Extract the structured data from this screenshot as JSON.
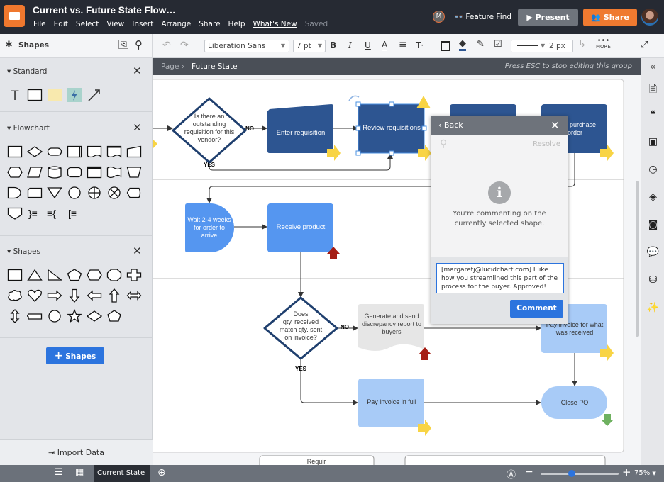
{
  "app": {
    "title": "Current vs. Future State Flow…",
    "menu": [
      "File",
      "Edit",
      "Select",
      "View",
      "Insert",
      "Arrange",
      "Share",
      "Help",
      "What's New"
    ],
    "saved": "Saved",
    "collab_initial": "M",
    "feature_find": "Feature Find",
    "present": "Present",
    "share": "Share"
  },
  "toolbar": {
    "font": "Liberation Sans",
    "font_size": "7 pt",
    "line_width": "2 px",
    "more": "MORE",
    "fill_color": "#2d5591"
  },
  "sidebar": {
    "title": "Shapes",
    "sections": [
      {
        "name": "Standard",
        "shapes": [
          "text",
          "rect",
          "note",
          "action",
          "arrow"
        ]
      },
      {
        "name": "Flowchart",
        "shapes": [
          "rect",
          "diamond",
          "terminator",
          "process2",
          "document",
          "doc2",
          "manual-input",
          "hexagon",
          "parallelogram",
          "cylinder",
          "direct-data",
          "internal",
          "tape",
          "trapezoid",
          "delay",
          "card",
          "triangle-down",
          "circle",
          "or",
          "sum",
          "display",
          "offpage",
          "brace-r",
          "brace-l",
          "bracket"
        ]
      },
      {
        "name": "Shapes",
        "shapes": [
          "rect",
          "triangle",
          "right-triangle",
          "pentagon",
          "hexagon",
          "octagon",
          "cross",
          "cloud",
          "heart",
          "arrow-right",
          "arrow-down",
          "arrow-left",
          "arrow-up",
          "arrow-lr",
          "arrow-ud",
          "callout",
          "circle",
          "star",
          "diamond",
          "polygon"
        ]
      }
    ],
    "add_shapes": "Shapes",
    "import_data": "Import Data"
  },
  "breadcrumb": {
    "root": "Page",
    "current": "Future State",
    "hint": "Press ESC to stop editing this group"
  },
  "diagram": {
    "colors": {
      "dark": "#2d5591",
      "mid": "#5596f0",
      "light": "#a8cbf7",
      "gray": "#e6e6e6",
      "yellow": "#f8d444",
      "red": "#a51d14",
      "green": "#6fb160"
    },
    "decision1": [
      "Is there an",
      "outstanding",
      "requisition for this",
      "vendor?"
    ],
    "enter_requisition": "Enter requisition",
    "review_requisitions": "Review requisitions",
    "purchase_order_fragment": [
      "t purchase",
      "order"
    ],
    "wait": [
      "Wait 2-4 weeks",
      "for order to",
      "arrive"
    ],
    "receive_product": "Receive product",
    "decision2": [
      "Does",
      "qty. received",
      "match qty. sent",
      "on invoice?"
    ],
    "discrepancy": [
      "Generate and send",
      "discrepancy report to",
      "buyers"
    ],
    "pay_received": [
      "Pay invoice for what",
      "was received"
    ],
    "pay_full": "Pay invoice in full",
    "close_po": "Close PO",
    "no": "NO",
    "yes": "YES",
    "bottom_fragment": "Requir"
  },
  "comment_panel": {
    "back": "Back",
    "resolve": "Resolve",
    "message": [
      "You're commenting on the",
      "currently selected shape."
    ],
    "input_value": "[margaretj@lucidchart.com] I like how you streamlined this part of the process for the buyer. Approved!",
    "submit": "Comment"
  },
  "bottom": {
    "page_tab": "Current State",
    "zoom": "75%",
    "zoom_level": 0.4
  }
}
